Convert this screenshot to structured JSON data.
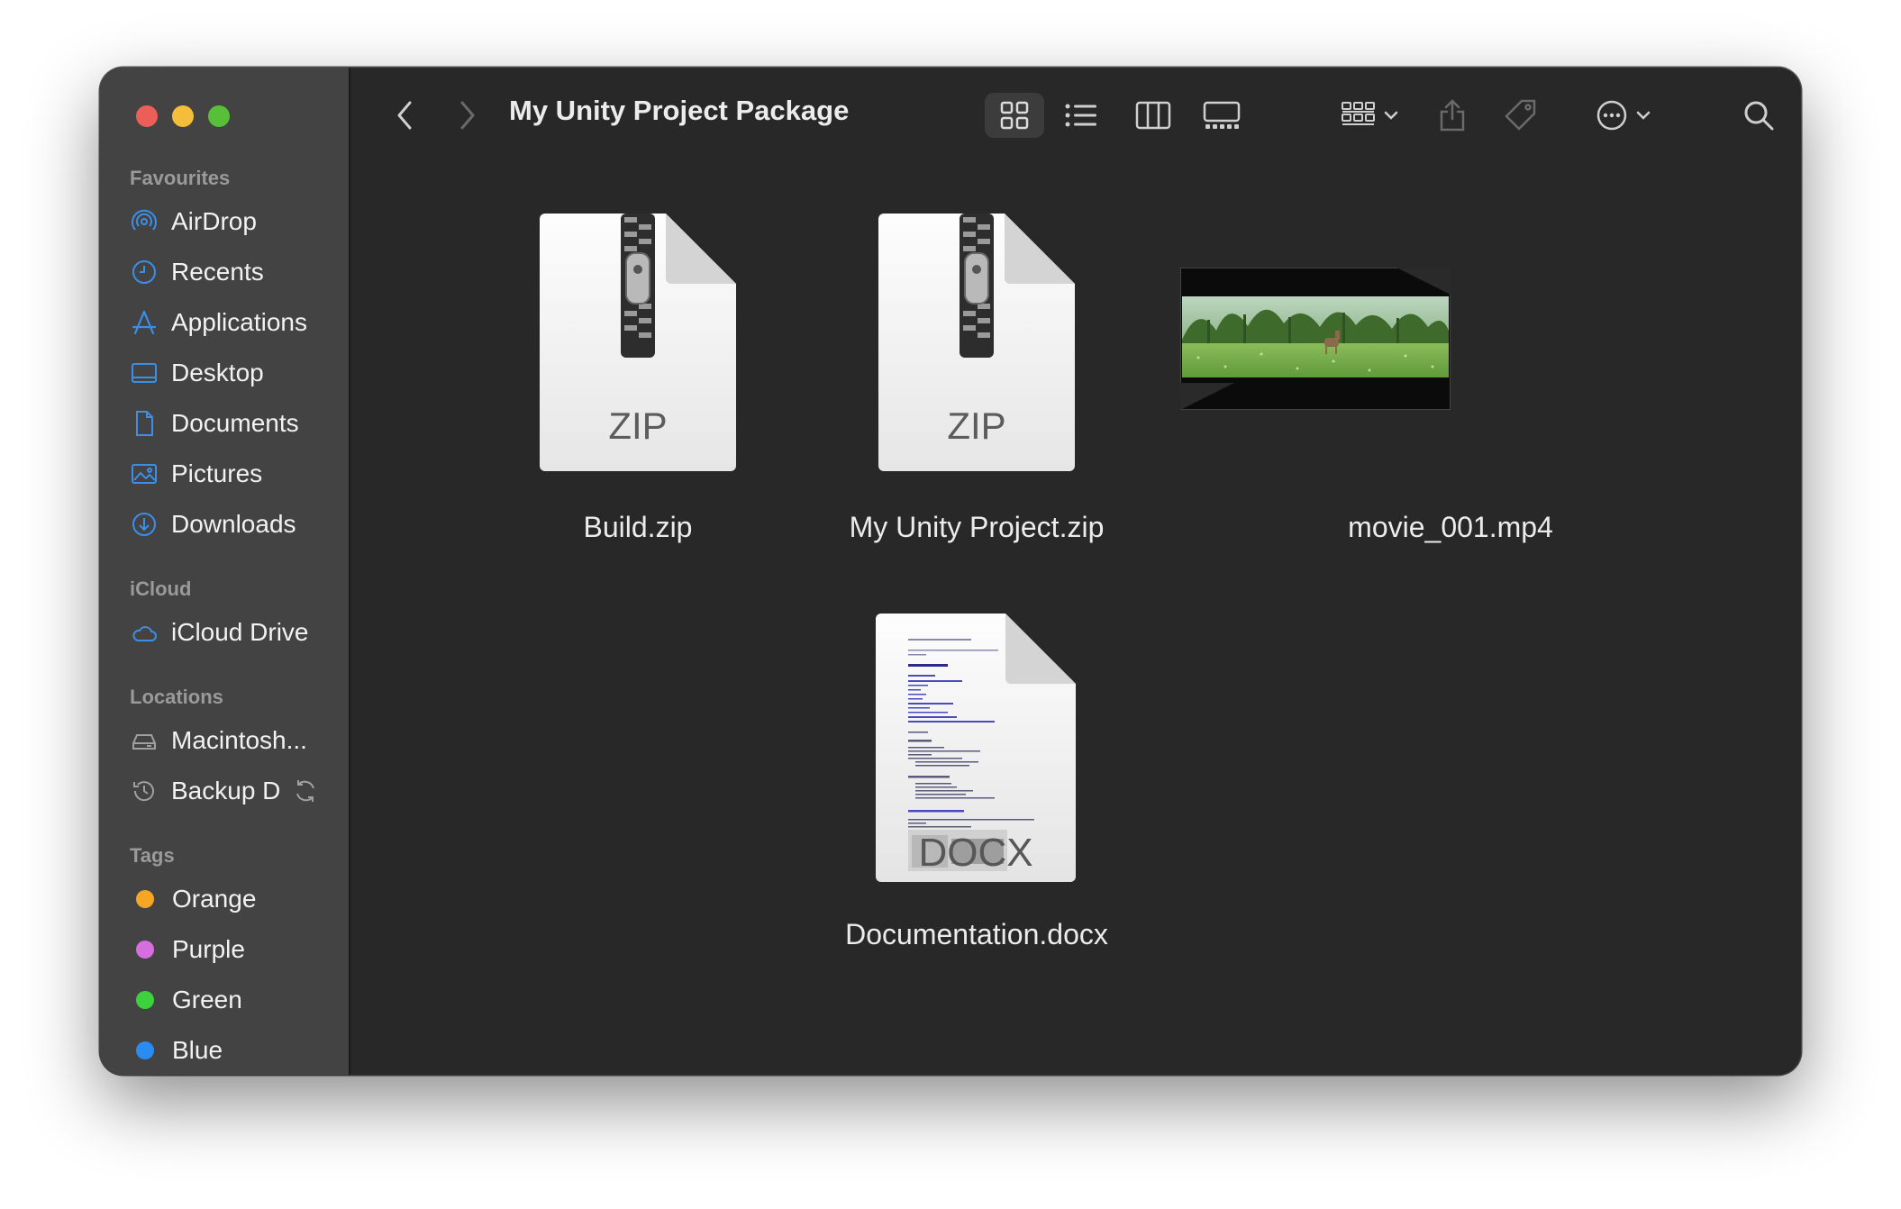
{
  "window": {
    "title": "My Unity Project Package"
  },
  "sidebar": {
    "sections": [
      {
        "label": "Favourites"
      },
      {
        "label": "iCloud"
      },
      {
        "label": "Locations"
      },
      {
        "label": "Tags"
      }
    ],
    "favourites": [
      {
        "label": "AirDrop",
        "icon": "airdrop-icon"
      },
      {
        "label": "Recents",
        "icon": "clock-icon"
      },
      {
        "label": "Applications",
        "icon": "applications-icon"
      },
      {
        "label": "Desktop",
        "icon": "desktop-icon"
      },
      {
        "label": "Documents",
        "icon": "document-icon"
      },
      {
        "label": "Pictures",
        "icon": "pictures-icon"
      },
      {
        "label": "Downloads",
        "icon": "downloads-icon"
      }
    ],
    "icloud": [
      {
        "label": "iCloud Drive",
        "icon": "cloud-icon"
      }
    ],
    "locations": [
      {
        "label": "Macintosh...",
        "icon": "disk-icon"
      },
      {
        "label": "Backup D",
        "icon": "time-machine-icon"
      }
    ],
    "tags": [
      {
        "label": "Orange",
        "color": "#f5a623"
      },
      {
        "label": "Purple",
        "color": "#d66ee0"
      },
      {
        "label": "Green",
        "color": "#3ed13e"
      },
      {
        "label": "Blue",
        "color": "#2a8cf0"
      }
    ]
  },
  "files": [
    {
      "name": "Build.zip",
      "kind": "ZIP"
    },
    {
      "name": "My Unity Project.zip",
      "kind": "ZIP"
    },
    {
      "name": "movie_001.mp4",
      "kind": "video"
    },
    {
      "name": "Documentation.docx",
      "kind": "DOCX"
    }
  ],
  "colors": {
    "sidebar_bg": "#434343",
    "content_bg": "#282828",
    "accent": "#2a8cf0"
  }
}
